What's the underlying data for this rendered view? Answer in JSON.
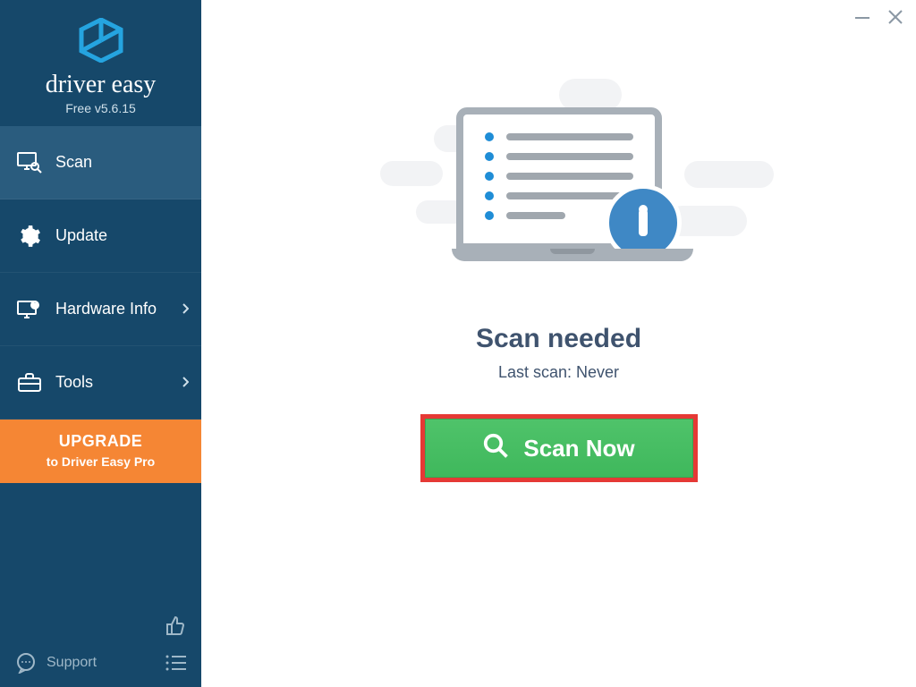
{
  "brand": {
    "name": "driver easy",
    "version": "Free v5.6.15"
  },
  "sidebar": {
    "items": [
      {
        "label": "Scan"
      },
      {
        "label": "Update"
      },
      {
        "label": "Hardware Info"
      },
      {
        "label": "Tools"
      }
    ],
    "upgrade": {
      "line1": "UPGRADE",
      "line2": "to Driver Easy Pro"
    },
    "support": "Support"
  },
  "main": {
    "headline": "Scan needed",
    "last_scan_label": "Last scan: Never",
    "scan_button": "Scan Now"
  }
}
